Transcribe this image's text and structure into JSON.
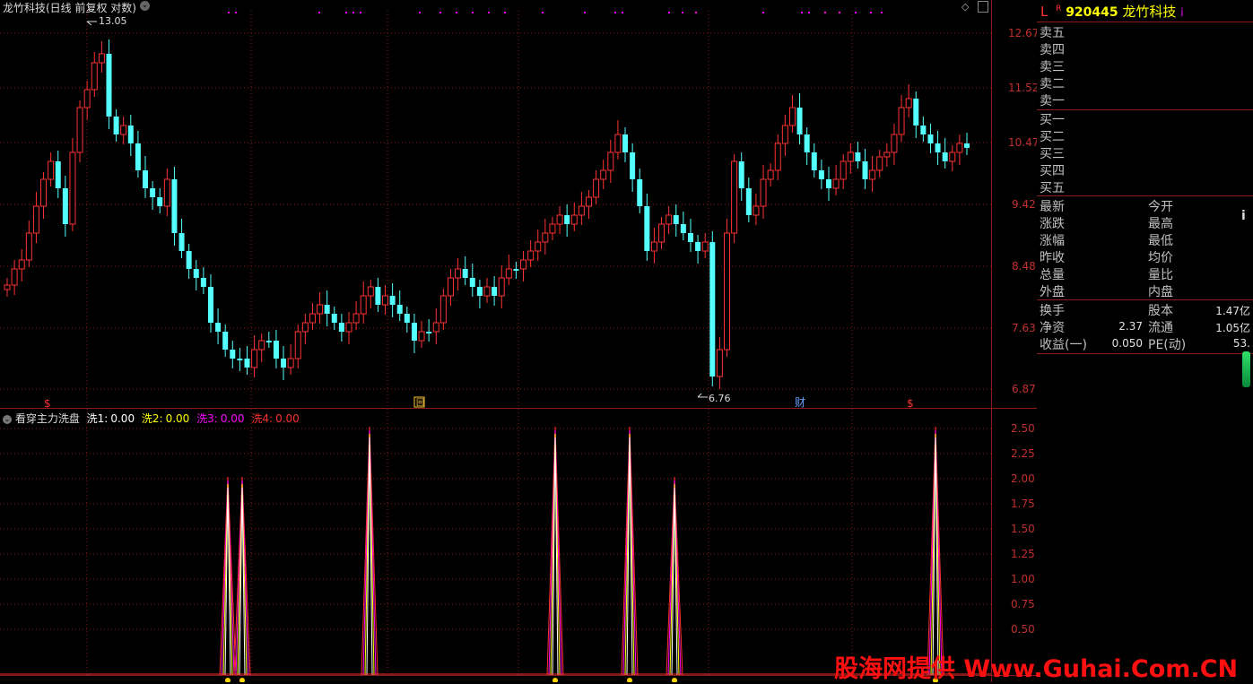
{
  "header": {
    "title": "龙竹科技(日线 前复权 对数)",
    "high_marker": "13.05",
    "low_marker": "6.76"
  },
  "price_axis": {
    "ticks": [
      "12.67",
      "11.52",
      "10.47",
      "9.42",
      "8.48",
      "7.63",
      "6.87"
    ]
  },
  "event_markers": {
    "dollar": "$",
    "box": "回",
    "finance": "财"
  },
  "indicator": {
    "name": "看穿主力洗盘",
    "items": [
      {
        "label": "洗1:",
        "value": "0.00",
        "color": "#ffffff"
      },
      {
        "label": "洗2:",
        "value": "0.00",
        "color": "#ffff00"
      },
      {
        "label": "洗3:",
        "value": "0.00",
        "color": "#ff00ff"
      },
      {
        "label": "洗4:",
        "value": "0.00",
        "color": "#ff3030"
      }
    ],
    "axis_ticks": [
      "2.50",
      "2.25",
      "2.00",
      "1.75",
      "1.50",
      "1.25",
      "1.00",
      "0.75",
      "0.50"
    ]
  },
  "quote": {
    "prefix": "L",
    "superscript": "R",
    "code": "920445",
    "name": "龙竹科技",
    "info_marker": "i",
    "sell_levels": [
      "卖五",
      "卖四",
      "卖三",
      "卖二",
      "卖一"
    ],
    "buy_levels": [
      "买一",
      "买二",
      "买三",
      "买四",
      "买五"
    ],
    "stats_left": [
      "最新",
      "涨跌",
      "涨幅",
      "昨收",
      "总量",
      "外盘"
    ],
    "stats_right": [
      "今开",
      "最高",
      "最低",
      "均价",
      "量比",
      "内盘"
    ],
    "fin": [
      {
        "label": "换手",
        "value": "",
        "label2": "股本",
        "value2": "1.47亿"
      },
      {
        "label": "净资",
        "value": "2.37",
        "label2": "流通",
        "value2": "1.05亿"
      },
      {
        "label": "收益(一)",
        "value": "0.050",
        "label2": "PE(动)",
        "value2": "53."
      }
    ]
  },
  "watermark": "股海网提供 Www.Guhai.Com.CN",
  "colors": {
    "up": "#ff3232",
    "down": "#54ffff",
    "grid": "#8b1a1a",
    "axis": "#c03030"
  }
}
